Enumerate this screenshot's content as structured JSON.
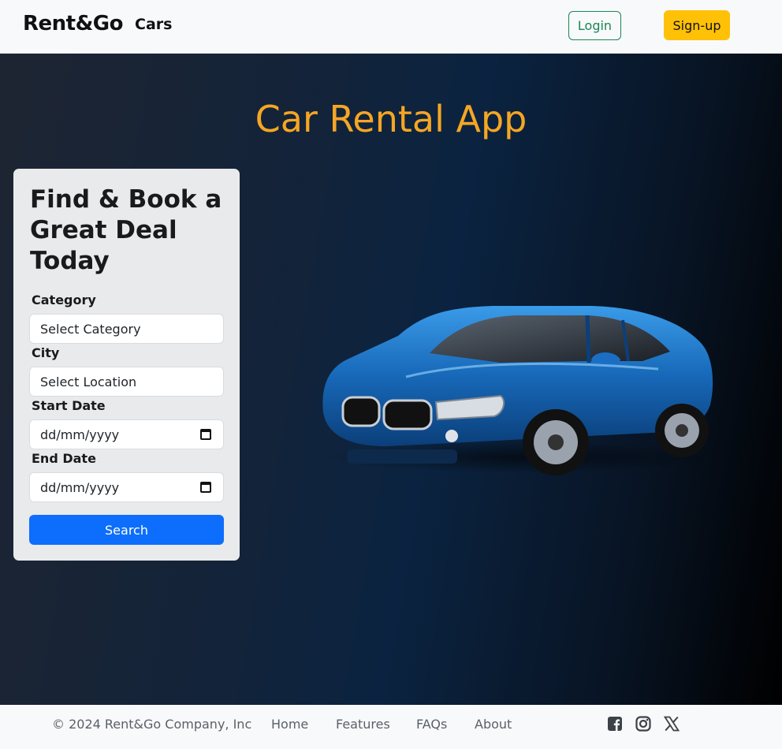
{
  "header": {
    "brand": "Rent&Go",
    "nav_cars": "Cars",
    "login": "Login",
    "signup": "Sign-up"
  },
  "hero": {
    "title": "Car Rental App"
  },
  "search_card": {
    "heading": "Find & Book a Great Deal Today",
    "category_label": "Category",
    "category_value": "Select Category",
    "city_label": "City",
    "city_value": "Select Location",
    "start_label": "Start Date",
    "start_value": "dd/mm/yyyy",
    "end_label": "End Date",
    "end_value": "dd/mm/yyyy",
    "search_button": "Search"
  },
  "footer": {
    "copyright": "© 2024 Rent&Go Company, Inc",
    "links": [
      "Home",
      "Features",
      "FAQs",
      "About"
    ],
    "social": [
      "facebook-icon",
      "instagram-icon",
      "x-icon"
    ]
  },
  "colors": {
    "accent_title": "#f5a623",
    "signup": "#ffc107",
    "login_border": "#198754",
    "search_button": "#0d6efd",
    "car_body": "#1a6fc4"
  }
}
